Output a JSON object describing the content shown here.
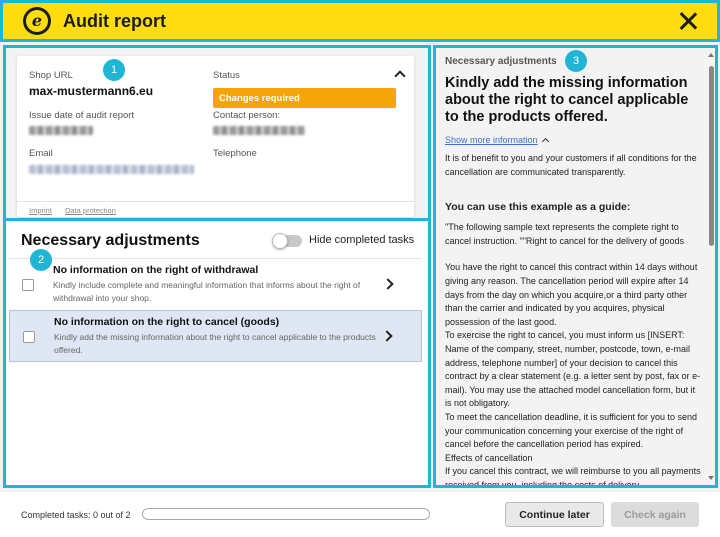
{
  "header": {
    "title": "Audit report",
    "logo_letter": "e"
  },
  "callouts": [
    "1",
    "2",
    "3"
  ],
  "shop_card": {
    "shop_url_label": "Shop URL",
    "shop_url": "max-mustermann6.eu",
    "status_label": "Status",
    "status_value": "Changes required",
    "issue_date_label": "Issue date of audit report",
    "contact_label": "Contact person:",
    "email_label": "Email",
    "telephone_label": "Telephone",
    "footer_links": [
      "Imprint",
      "Data protection"
    ]
  },
  "adjustments": {
    "title": "Necessary adjustments",
    "toggle_label": "Hide completed tasks",
    "toggle_on": false,
    "tasks": [
      {
        "title": "No information on the right of withdrawal",
        "description": "Kindly include complete and meaningful information that informs about the right of withdrawal into your shop.",
        "selected": false
      },
      {
        "title": "No information on the right to cancel (goods)",
        "description": "Kindly add the missing information about the right to cancel applicable to the products offered.",
        "selected": true
      }
    ]
  },
  "detail": {
    "label": "Necessary adjustments",
    "heading": "Kindly add the missing information about the right to cancel applicable to the products offered.",
    "show_more": "Show more information",
    "intro": "It is of benefit to you and your customers if all conditions for the cancellation are communicated transparently.",
    "guide_title": "You can use this example as a guide:",
    "guide_intro": "\"The following sample text represents the complete right to cancel instruction. \"\"Right to cancel for the delivery of goods",
    "paragraphs": [
      "You have the right to cancel this contract within 14 days without giving any reason. The cancellation period will expire after 14 days from the day on which you acquire,or a third party other than the carrier and indicated by you acquires, physical possession of the last good.",
      "To exercise the right to cancel, you must inform us [INSERT: Name of the company, street, number, postcode, town, e-mail address, telephone number] of your decision to cancel this contract by a clear statement (e.g. a letter sent by post, fax or e-mail). You may use the attached model cancellation form, but it is not obligatory.",
      "To meet the cancellation deadline, it is sufficient for you to send your communication concerning your exercise of the right of cancel before the cancellation period has expired.",
      "Effects of cancellation",
      "If you cancel this contract, we will reimburse to you all payments received from you, including the costs of delivery"
    ]
  },
  "footer": {
    "completed_label": "Completed tasks: 0 out of 2",
    "progress_fraction": 0,
    "continue_label": "Continue later",
    "check_label": "Check again"
  },
  "colors": {
    "accent": "#1fb6d6",
    "header_bg": "#ffdc0f",
    "status_orange": "#f5a40a",
    "link_blue": "#3a6fd8"
  }
}
